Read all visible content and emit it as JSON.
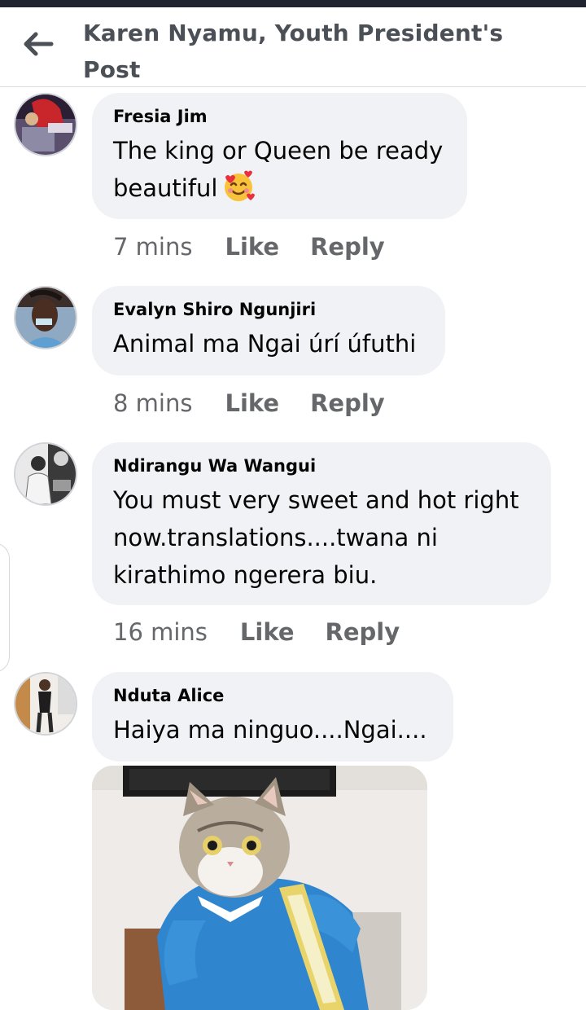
{
  "header": {
    "title": "Karen Nyamu, Youth President's Post"
  },
  "comments": [
    {
      "author": "Fresia Jim",
      "text": "The king or Queen be ready beautiful",
      "emoji": "smiling-face-with-hearts",
      "time": "7 mins",
      "like": "Like",
      "reply": "Reply"
    },
    {
      "author": "Evalyn Shiro Ngunjiri",
      "text": "Animal ma Ngai úrí úfuthi",
      "time": "8 mins",
      "like": "Like",
      "reply": "Reply"
    },
    {
      "author": "Ndirangu Wa Wangui",
      "text": "You must very sweet and hot right now.translations....twana ni kirathimo ngerera biu.",
      "time": "16 mins",
      "like": "Like",
      "reply": "Reply"
    },
    {
      "author": "Nduta Alice",
      "text": "Haiya ma ninguo....Ngai....",
      "attachment": "cat-in-costume-photo"
    }
  ],
  "icons": {
    "back": "back-arrow-icon"
  },
  "colors": {
    "bubble": "#f0f2f5",
    "meta": "#65676b",
    "title": "#4b4f56"
  }
}
